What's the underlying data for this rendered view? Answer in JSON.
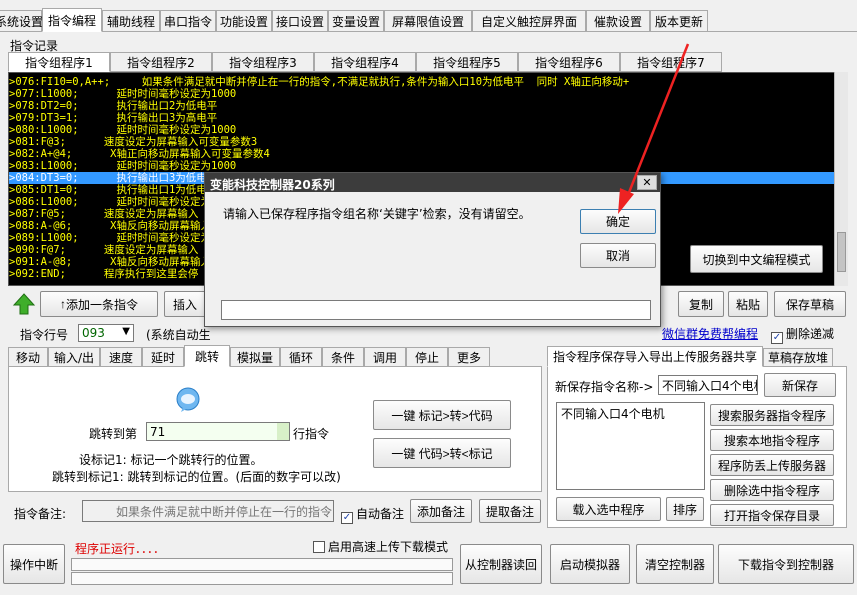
{
  "main_tabs": [
    "系统设置",
    "指令编程",
    "辅助线程",
    "串口指令",
    "功能设置",
    "接口设置",
    "变量设置",
    "屏幕限值设置",
    "自定义触控屏界面",
    "催款设置",
    "版本更新"
  ],
  "section_label": "指令记录",
  "group_tabs": [
    "指令组程序1",
    "指令组程序2",
    "指令组程序3",
    "指令组程序4",
    "指令组程序5",
    "指令组程序6",
    "指令组程序7"
  ],
  "code_lines": [
    ">076:FI10=0,A++;     如果条件满足就中断并停止在一行的指令,不满足就执行,条件为输入口10为低电平  同时 X轴正向移动+",
    ">077:L1000;      延时时间毫秒设定为1000",
    ">078:DT2=0;      执行输出口2为低电平",
    ">079:DT3=1;      执行输出口3为高电平",
    ">080:L1000;      延时时间毫秒设定为1000",
    ">081:F@3;      速度设定为屏幕输入可变量参数3",
    ">082:A+@4;      X轴正向移动屏幕输入可变量参数4",
    ">083:L1000;      延时时间毫秒设定为1000",
    ">084:DT3=0;      执行输出口3为低电",
    ">085:DT1=0;      执行输出口1为低电",
    ">086:L1000;      延时时间毫秒设定为",
    ">087:F@5;      速度设定为屏幕输入",
    ">088:A-@6;      X轴反向移动屏幕输入",
    ">089:L1000;      延时时间毫秒设定为",
    ">090:F@7;      速度设定为屏幕输入",
    ">091:A-@8;      X轴反向移动屏幕输入",
    ">092:END;      程序执行到这里会停"
  ],
  "toolbar": {
    "add": "添加一条指令",
    "insert": "插入",
    "copy": "复制",
    "paste": "粘贴",
    "save_draft": "保存草稿",
    "switch_mode": "切换到中文编程模式"
  },
  "line_row": {
    "label": "指令行号",
    "value": "093",
    "note": "(系统自动生",
    "link": "微信群免费帮编程",
    "delete_recursive": "删除递减"
  },
  "cmd_tabs": [
    "移动",
    "输入/出",
    "速度",
    "延时",
    "跳转",
    "模拟量",
    "循环",
    "条件",
    "调用",
    "停止",
    "更多"
  ],
  "jump": {
    "label_pre": "跳转到第",
    "value": "71",
    "label_post": "行指令",
    "btn1": "一键 标记>转>代码",
    "btn2": "一键 代码>转<标记",
    "desc1": "设标记1: 标记一个跳转行的位置。",
    "desc2": "跳转到标记1: 跳转到标记的位置。(后面的数字可以改)"
  },
  "remark": {
    "label": "指令备注:",
    "value": "如果条件满足就中断并停止在一行的指令",
    "auto_label": "自动备注",
    "add": "添加备注",
    "extract": "提取备注"
  },
  "right_panel": {
    "tab1": "指令程序保存导入导出上传服务器共享",
    "tab2": "草稿存放堆",
    "name_label": "新保存指令名称->",
    "name_value": "不同输入口4个电机",
    "new_save": "新保存",
    "list_items": [
      "不同输入口4个电机"
    ],
    "btn_search_server": "搜索服务器指令程序",
    "btn_search_local": "搜索本地指令程序",
    "btn_upload": "程序防丢上传服务器",
    "btn_delete": "删除选中指令程序",
    "btn_open_dir": "打开指令保存目录",
    "btn_load": "载入选中程序",
    "btn_sort": "排序"
  },
  "bottom": {
    "abort": "操作中断",
    "status": "程序正运行．．．．",
    "highspeed": "启用高速上传下载模式",
    "read": "从控制器读回",
    "simulate": "启动模拟器",
    "clear": "清空控制器",
    "download": "下载指令到控制器"
  },
  "dialog": {
    "title": "变能科技控制器20系列",
    "message": "请输入已保存程序指令组名称‘关键字’检索，没有请留空。",
    "ok": "确定",
    "cancel": "取消",
    "input_value": ""
  },
  "colors": {
    "code_bg": "#000000",
    "code_text": "#ffff00",
    "selection": "#3399ff",
    "dialog_title": "#3c3c3c",
    "status_red": "#dd0000",
    "arrow": "#ee2222"
  }
}
